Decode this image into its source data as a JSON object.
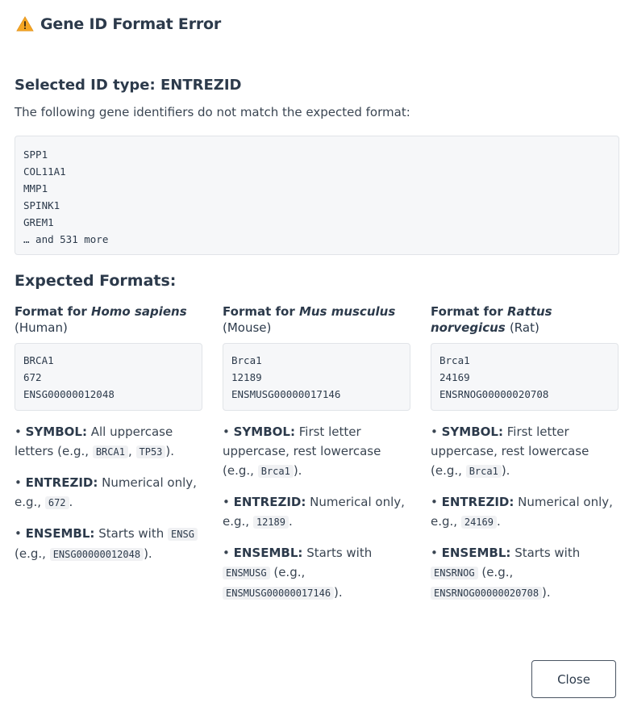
{
  "header": {
    "icon": "warning-icon",
    "title": "Gene ID Format Error"
  },
  "selected": {
    "title": "Selected ID type: ENTREZID",
    "intro": "The following gene identifiers do not match the expected format:",
    "ids": [
      "SPP1",
      "COL11A1",
      "MMP1",
      "SPINK1",
      "GREM1",
      "… and 531 more"
    ]
  },
  "expected": {
    "title": "Expected Formats:",
    "columns": [
      {
        "prefix": "Format for ",
        "species": "Homo sapiens",
        "common": "(Human)",
        "examples": [
          "BRCA1",
          "672",
          "ENSG00000012048"
        ],
        "symbol_label": "SYMBOL:",
        "symbol_text": "All uppercase letters (e.g.,",
        "symbol_code1": "BRCA1",
        "symbol_code2": "TP53",
        "entrez_label": "ENTREZID:",
        "entrez_text": "Numerical only, e.g.,",
        "entrez_code": "672",
        "ensembl_label": "ENSEMBL:",
        "ensembl_text": "Starts with",
        "ensembl_prefix": "ENSG",
        "ensembl_eg": "ENSG00000012048"
      },
      {
        "prefix": "Format for ",
        "species": "Mus musculus",
        "common": "(Mouse)",
        "examples": [
          "Brca1",
          "12189",
          "ENSMUSG00000017146"
        ],
        "symbol_label": "SYMBOL:",
        "symbol_text": "First letter uppercase, rest lowercase (e.g.,",
        "symbol_code1": "Brca1",
        "entrez_label": "ENTREZID:",
        "entrez_text": "Numerical only, e.g.,",
        "entrez_code": "12189",
        "ensembl_label": "ENSEMBL:",
        "ensembl_text": "Starts with",
        "ensembl_prefix": "ENSMUSG",
        "ensembl_eg": "ENSMUSG00000017146"
      },
      {
        "prefix": "Format for ",
        "species": "Rattus norvegicus",
        "common": "(Rat)",
        "examples": [
          "Brca1",
          "24169",
          "ENSRNOG00000020708"
        ],
        "symbol_label": "SYMBOL:",
        "symbol_text": "First letter uppercase, rest lowercase (e.g.,",
        "symbol_code1": "Brca1",
        "entrez_label": "ENTREZID:",
        "entrez_text": "Numerical only, e.g.,",
        "entrez_code": "24169",
        "ensembl_label": "ENSEMBL:",
        "ensembl_text": "Starts with",
        "ensembl_prefix": "ENSRNOG",
        "ensembl_eg": "ENSRNOG00000020708"
      }
    ]
  },
  "footer": {
    "close_label": "Close"
  },
  "colors": {
    "warning": "#f5a623",
    "text": "#2c3a4b",
    "code_bg": "#f6f7f9"
  }
}
